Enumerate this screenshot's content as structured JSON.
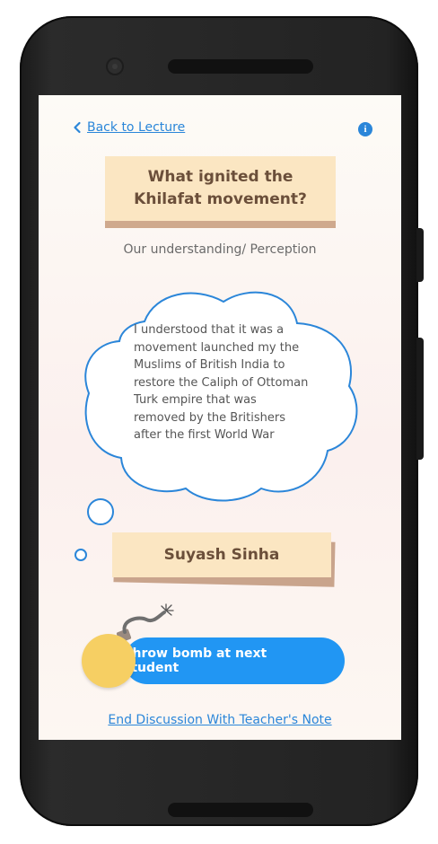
{
  "nav": {
    "back_label": "Back to Lecture"
  },
  "question": {
    "title": "What ignited the Khilafat movement?"
  },
  "section": {
    "subtitle": "Our understanding/ Perception"
  },
  "answer": {
    "text": "I understood that it was a movement launched my the Muslims of British India to restore the Caliph of Ottoman Turk empire that was removed by the Britishers after the first World War"
  },
  "student": {
    "name": "Suyash Sinha"
  },
  "actions": {
    "throw_bomb_label": "Throw bomb at next student",
    "end_discussion_label": "End Discussion With Teacher's Note"
  },
  "colors": {
    "accent": "#2196f3",
    "link": "#2b86d9",
    "card": "#fbe6c2",
    "card_edge": "#cfa98d",
    "bomb": "#f6cf63"
  },
  "icons": [
    "chevron-left-icon",
    "info-icon",
    "bomb-icon"
  ]
}
